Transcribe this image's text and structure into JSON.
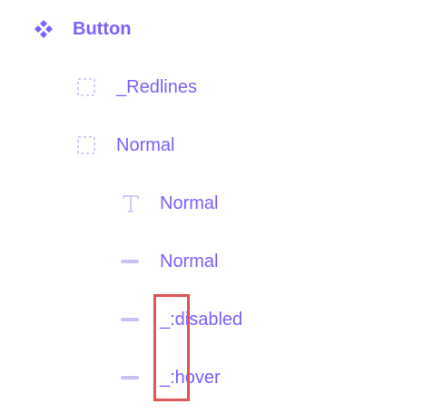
{
  "layers": {
    "component": {
      "label": "Button",
      "icon": "component-icon"
    },
    "redlines": {
      "label": "_Redlines",
      "icon": "frame-icon"
    },
    "normal_frame": {
      "label": "Normal",
      "icon": "frame-icon"
    },
    "text_layer": {
      "label": "Normal",
      "icon": "text-icon"
    },
    "line_normal": {
      "label": "Normal",
      "icon": "line-icon"
    },
    "line_disabled": {
      "label": "_:disabled",
      "icon": "line-icon"
    },
    "line_hover": {
      "label": "_:hover",
      "icon": "line-icon"
    }
  },
  "colors": {
    "accent": "#7b61ff",
    "icon_muted": "#c8c0f5",
    "highlight": "#e05555"
  }
}
